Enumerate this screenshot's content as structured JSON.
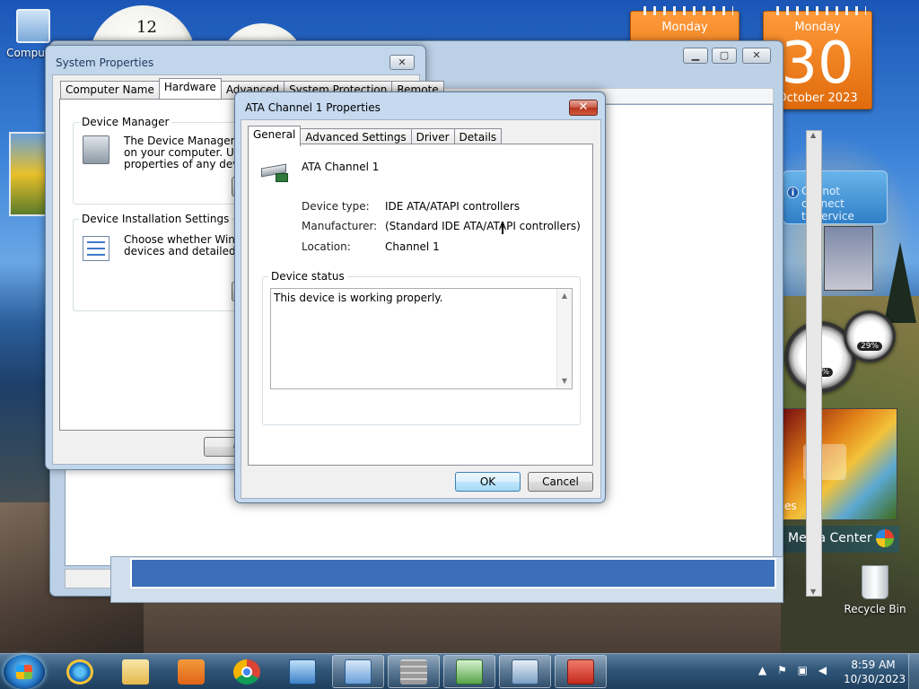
{
  "desktop": {
    "icons": {
      "computer": "Computer",
      "recycle_bin": "Recycle Bin"
    },
    "clock": {
      "twelve": "12"
    },
    "calendar_left": {
      "day": "Monday"
    },
    "calendar_right": {
      "day": "Monday",
      "date": "30",
      "month_year": "October 2023"
    },
    "weather": {
      "message_line1": "Cannot connect",
      "message_line2": "to service",
      "info_icon": "i"
    },
    "cpu_meter": {
      "cpu_percent": "01%",
      "memory_percent": "29%"
    },
    "media_center": {
      "label": "Media Center",
      "partial_text": "es"
    }
  },
  "background_window": {
    "buttons": {
      "minimize": "▁",
      "maximize": "▢",
      "close": "✕"
    },
    "scroll_up": "▲",
    "scroll_down": "▼"
  },
  "system_properties": {
    "title": "System Properties",
    "close": "✕",
    "tabs": [
      "Computer Name",
      "Hardware",
      "Advanced",
      "System Protection",
      "Remote"
    ],
    "device_manager": {
      "heading": "Device Manager",
      "text_line1": "The Device Manager lists a",
      "text_line2": "on your computer. Use the",
      "text_line3": "properties of any device."
    },
    "device_installation": {
      "heading": "Device Installation Settings",
      "text_line1": "Choose whether Windows",
      "text_line2": "devices and detailed infom"
    },
    "ok_partial": "O"
  },
  "ata_properties": {
    "title": "ATA Channel 1 Properties",
    "close": "✕",
    "tabs": [
      "General",
      "Advanced Settings",
      "Driver",
      "Details"
    ],
    "device_name": "ATA Channel 1",
    "fields": {
      "device_type_label": "Device type:",
      "device_type_value": "IDE ATA/ATAPI controllers",
      "manufacturer_label": "Manufacturer:",
      "manufacturer_value": "(Standard IDE ATA/ATAPI controllers)",
      "location_label": "Location:",
      "location_value": "Channel 1"
    },
    "device_status": {
      "label": "Device status",
      "text": "This device is working properly."
    },
    "ok_label": "OK",
    "cancel_label": "Cancel"
  },
  "taskbar": {
    "time": "8:59 AM",
    "date": "10/30/2023"
  }
}
